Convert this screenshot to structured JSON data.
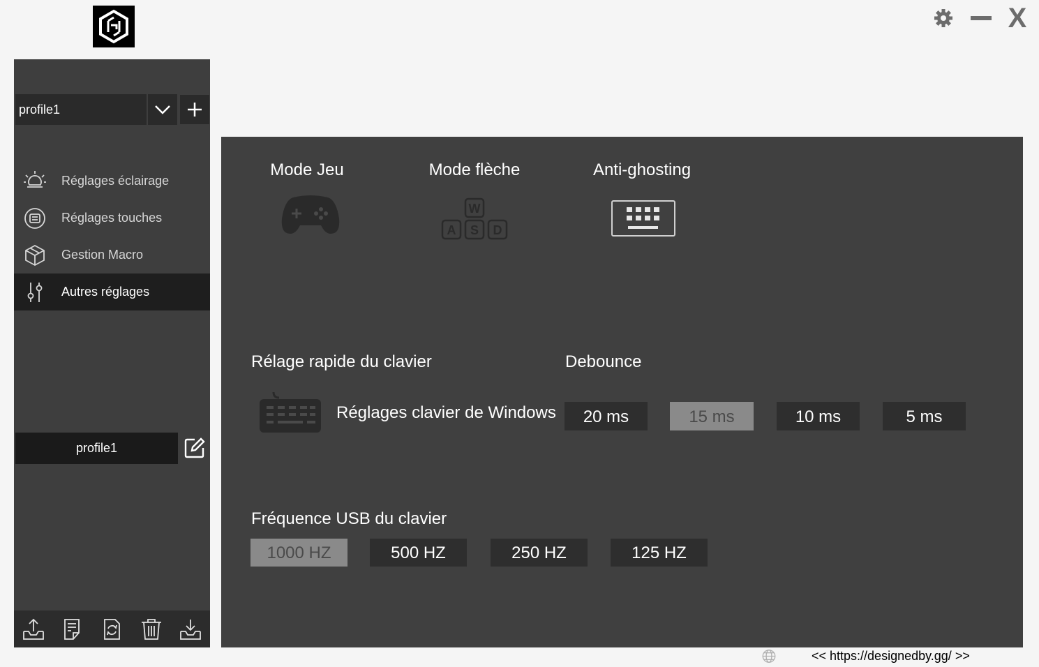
{
  "colors": {
    "page_bg": "#f5f5f5",
    "sidebar_bg": "#3e3e3e",
    "panel_bg": "#404040",
    "button_bg": "#2e2e2e",
    "selected_bg": "#8a8a8a",
    "active_nav_bg": "#1e1e1e"
  },
  "window_controls": {
    "settings_icon": "gear-icon",
    "minimize_icon": "minimize-icon",
    "close_label": "X"
  },
  "sidebar": {
    "profile_select_value": "profile1",
    "nav": [
      {
        "label": "Réglages éclairage",
        "icon": "lightbulb-icon"
      },
      {
        "label": "Réglages touches",
        "icon": "keyboard-circle-icon"
      },
      {
        "label": "Gestion Macro",
        "icon": "cube-icon"
      },
      {
        "label": "Autres réglages",
        "icon": "sliders-icon",
        "active": true
      }
    ],
    "profile_name": "profile1",
    "bottom_buttons": [
      "export-icon",
      "document-icon",
      "refresh-icon",
      "trash-icon",
      "import-icon"
    ]
  },
  "main": {
    "modes": [
      {
        "title": "Mode Jeu",
        "icon": "gamepad-icon"
      },
      {
        "title": "Mode flèche",
        "icon": "wasd-keys-icon"
      },
      {
        "title": "Anti-ghosting",
        "icon": "keyboard-icon"
      }
    ],
    "quick_settings": {
      "title": "Rélage rapide du clavier",
      "windows_label": "Réglages clavier de Windows"
    },
    "debounce": {
      "title": "Debounce",
      "options": [
        "20 ms",
        "15 ms",
        "10 ms",
        "5 ms"
      ],
      "selected": "15 ms"
    },
    "usb": {
      "title": "Fréquence USB du clavier",
      "options": [
        "1000 HZ",
        "500 HZ",
        "250 HZ",
        "125 HZ"
      ],
      "selected": "1000 HZ"
    }
  },
  "footer": {
    "link": "<< https://designedby.gg/ >>"
  }
}
